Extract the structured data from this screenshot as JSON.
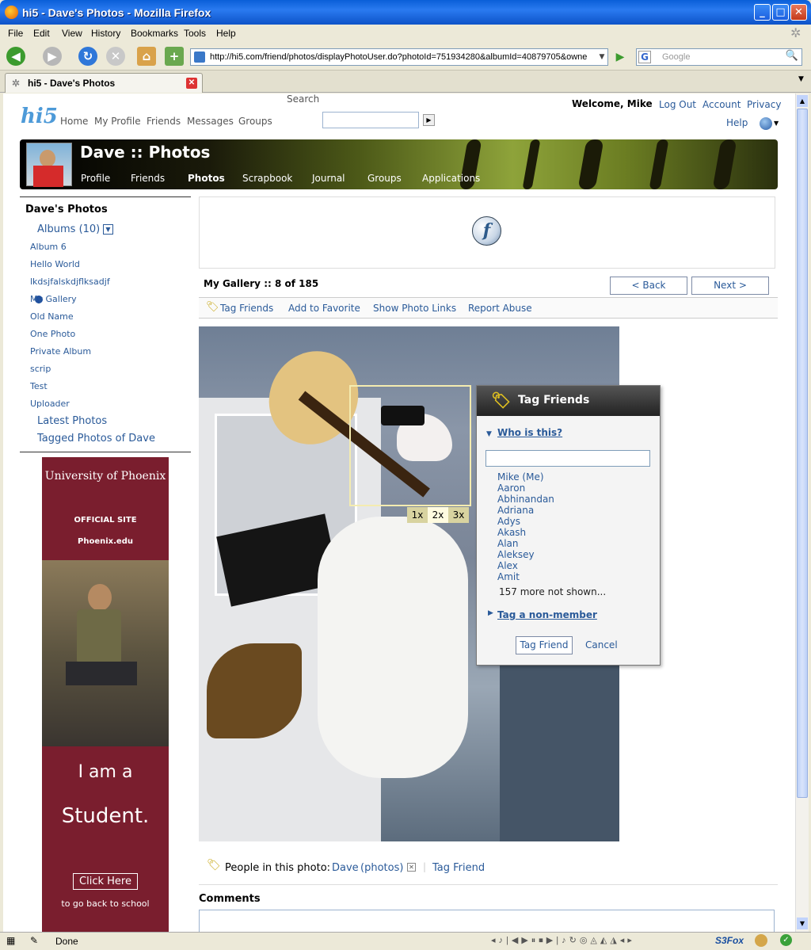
{
  "window": {
    "title": "hi5 - Dave's Photos - Mozilla Firefox"
  },
  "menu": [
    "File",
    "Edit",
    "View",
    "History",
    "Bookmarks",
    "Tools",
    "Help"
  ],
  "toolbar": {
    "url": "http://hi5.com/friend/photos/displayPhotoUser.do?photoId=751934280&albumId=40879705&owne",
    "search_placeholder": "Google"
  },
  "tab": {
    "label": "hi5 - Dave's Photos"
  },
  "header": {
    "logo": "hi5",
    "nav": [
      "Home",
      "My Profile",
      "Friends",
      "Messages",
      "Groups"
    ],
    "search_label": "Search",
    "welcome": "Welcome, Mike",
    "links": [
      "Log Out",
      "Account",
      "Privacy"
    ],
    "help": "Help"
  },
  "banner": {
    "title": "Dave :: Photos",
    "tabs": [
      "Profile",
      "Friends",
      "Photos",
      "Scrapbook",
      "Journal",
      "Groups",
      "Applications"
    ]
  },
  "sidebar": {
    "heading": "Dave's Photos",
    "albums_label": "Albums (10)",
    "albums": [
      "Album 6",
      "Hello World",
      "lkdsjfalskdjflksadjf",
      "My Gallery",
      "Old Name",
      "One Photo",
      "Private Album",
      "scrip",
      "Test",
      "Uploader"
    ],
    "latest": "Latest Photos",
    "tagged": "Tagged Photos of Dave"
  },
  "ad": {
    "brand": "University of Phoenix",
    "official": "OFFICIAL SITE",
    "site": "Phoenix.edu",
    "line1": "I am a",
    "line2": "Student.",
    "button": "Click Here",
    "tagline": "to go back to school"
  },
  "gallery": {
    "name": "My Gallery",
    "sep": "::",
    "count": "8 of 185",
    "back": "< Back",
    "next": "Next >"
  },
  "actions": [
    "Tag Friends",
    "Add to Favorite",
    "Show Photo Links",
    "Report Abuse"
  ],
  "zoom": [
    "1x",
    "2x",
    "3x"
  ],
  "tag_panel": {
    "title": "Tag Friends",
    "who": "Who is this?",
    "friends": [
      "Mike (Me)",
      "Aaron",
      "Abhinandan",
      "Adriana",
      "Adys",
      "Akash",
      "Alan",
      "Aleksey",
      "Alex",
      "Amit"
    ],
    "more": "157 more not shown...",
    "nonmember": "Tag a non-member",
    "tag_button": "Tag Friend",
    "cancel": "Cancel"
  },
  "people": {
    "label": "People in this photo:",
    "name": "Dave",
    "photos": "(photos)",
    "tag": "Tag Friend"
  },
  "comments": {
    "heading": "Comments"
  },
  "status": {
    "text": "Done",
    "addon": "S3Fox"
  }
}
